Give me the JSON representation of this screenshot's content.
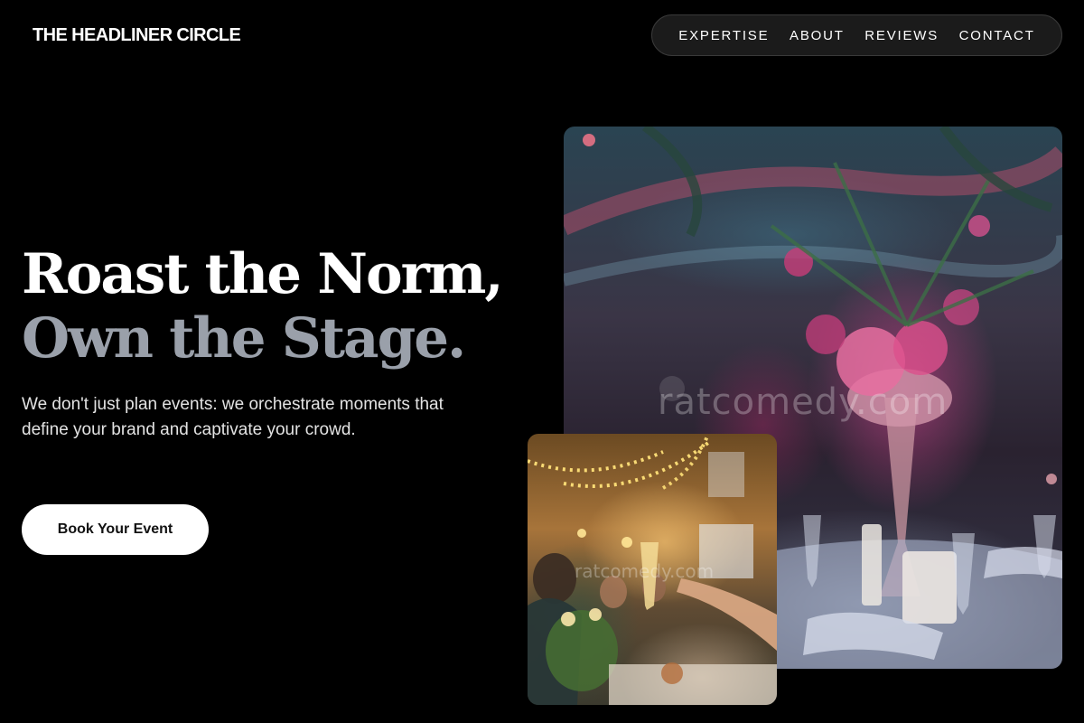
{
  "header": {
    "brand": "THE HEADLINER CIRCLE",
    "nav": [
      "EXPERTISE",
      "ABOUT",
      "REVIEWS",
      "CONTACT"
    ]
  },
  "hero": {
    "headline_line1": "Roast the Norm,",
    "headline_line2": "Own the Stage.",
    "lead": "We don't just plan events: we orchestrate moments that define your brand and captivate your crowd.",
    "cta_label": "Book Your Event"
  },
  "images": {
    "main_watermark": "ratcomedy.com",
    "small_watermark": "ratcomedy.com"
  },
  "colors": {
    "background": "#000000",
    "headline_primary": "#ffffff",
    "headline_secondary": "#9aa0aa",
    "nav_pill": "#1b1b1b",
    "cta_background": "#ffffff"
  }
}
